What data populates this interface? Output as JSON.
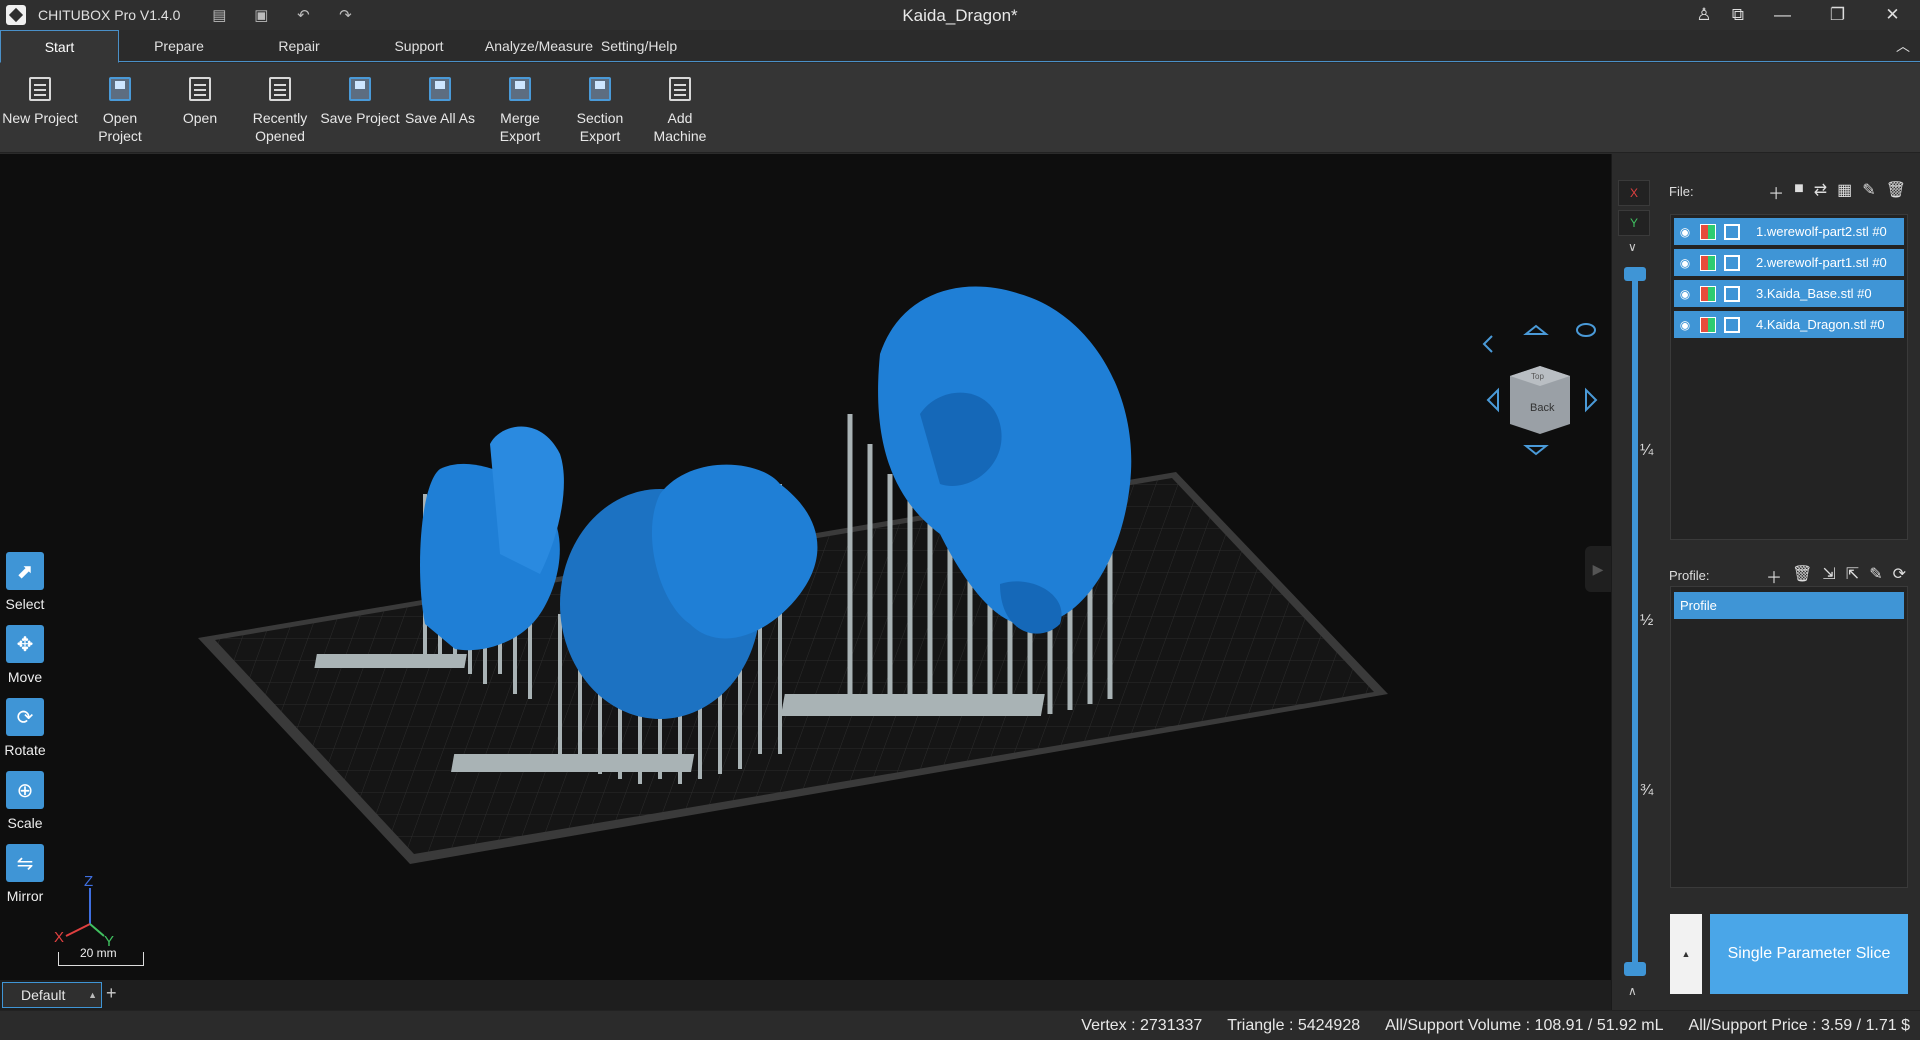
{
  "app": {
    "name": "CHITUBOX Pro V1.4.0",
    "document_title": "Kaida_Dragon*"
  },
  "quick_access": [
    "export-icon",
    "save-icon",
    "undo-icon",
    "redo-icon"
  ],
  "window_controls": [
    "user-icon",
    "screen-icon",
    "minimize-icon",
    "restore-icon",
    "close-icon"
  ],
  "tabs": [
    {
      "label": "Start",
      "active": true
    },
    {
      "label": "Prepare"
    },
    {
      "label": "Repair"
    },
    {
      "label": "Support"
    },
    {
      "label": "Analyze/Measure"
    },
    {
      "label": "Setting/Help"
    }
  ],
  "ribbon": [
    {
      "label": "New Project",
      "icon": "new-project-icon"
    },
    {
      "label": "Open\nProject",
      "icon": "open-project-icon"
    },
    {
      "label": "Open",
      "icon": "open-icon"
    },
    {
      "label": "Recently\nOpened",
      "icon": "recent-icon"
    },
    {
      "label": "Save Project",
      "icon": "save-project-icon"
    },
    {
      "label": "Save All As",
      "icon": "save-all-icon"
    },
    {
      "label": "Merge\nExport",
      "icon": "merge-export-icon"
    },
    {
      "label": "Section\nExport",
      "icon": "section-export-icon"
    },
    {
      "label": "Add\nMachine",
      "icon": "add-machine-icon"
    }
  ],
  "tools": [
    {
      "label": "Select",
      "icon": "select-icon"
    },
    {
      "label": "Move",
      "icon": "move-icon"
    },
    {
      "label": "Rotate",
      "icon": "rotate-icon"
    },
    {
      "label": "Scale",
      "icon": "scale-icon"
    },
    {
      "label": "Mirror",
      "icon": "mirror-icon"
    }
  ],
  "navcube": {
    "face": "Back",
    "top_face": "Top"
  },
  "axis": {
    "x": "X",
    "y": "Y",
    "z": "Z",
    "scale": "20 mm"
  },
  "plate_tab": {
    "label": "Default"
  },
  "layer_panel": {
    "axis_x": "X",
    "axis_y": "Y",
    "marks": [
      "¼",
      "½",
      "¾"
    ],
    "slider_top": 1.0,
    "slider_bottom": 0.0
  },
  "file_panel": {
    "label": "File:",
    "files": [
      {
        "name": "1.werewolf-part2.stl #0"
      },
      {
        "name": "2.werewolf-part1.stl #0"
      },
      {
        "name": "3.Kaida_Base.stl #0"
      },
      {
        "name": "4.Kaida_Dragon.stl #0"
      }
    ]
  },
  "profile_panel": {
    "label": "Profile:",
    "selected": "Profile"
  },
  "slice_button": {
    "label": "Single Parameter Slice"
  },
  "status": {
    "vertex": "Vertex : 2731337",
    "triangle": "Triangle : 5424928",
    "volume": "All/Support Volume : 108.91 / 51.92 mL",
    "price": "All/Support Price : 3.59 / 1.71 $"
  },
  "colors": {
    "accent": "#3f95d6",
    "model": "#1f7fd6",
    "support": "#a9b3b5",
    "plate": "#1a1a1a"
  }
}
